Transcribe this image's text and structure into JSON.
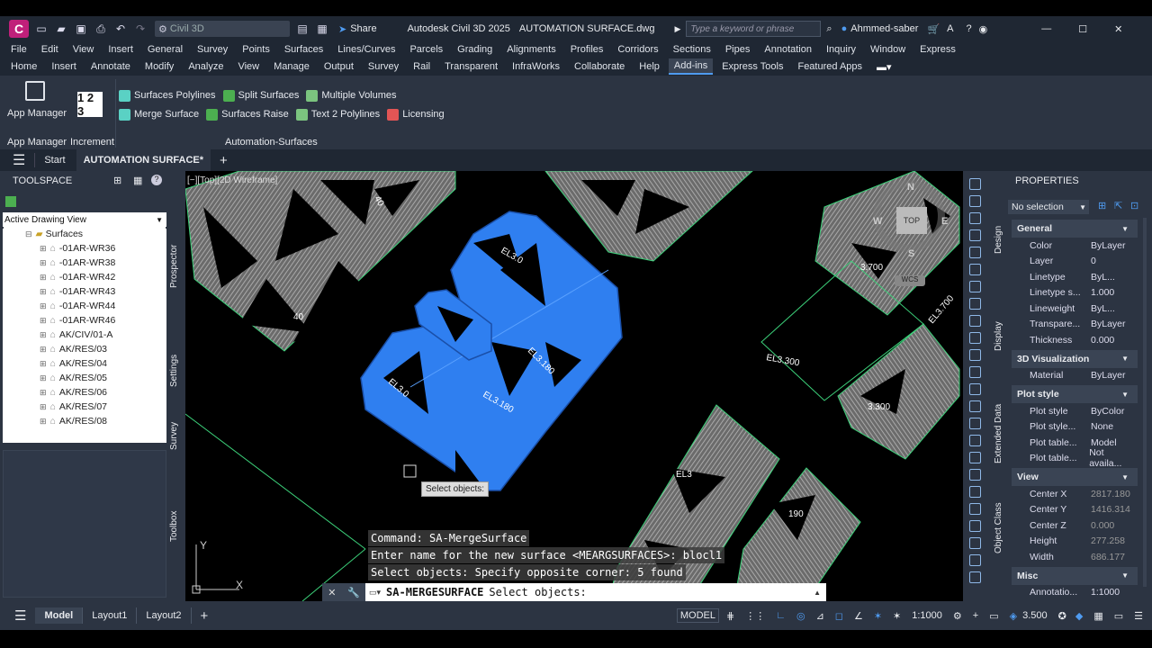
{
  "app": {
    "title": "Autodesk Civil 3D 2025",
    "file": "AUTOMATION SURFACE.dwg",
    "workspace": "Civil 3D",
    "share": "Share",
    "search_placeholder": "Type a keyword or phrase",
    "user": "Ahmmed-saber"
  },
  "menu": [
    "File",
    "Edit",
    "View",
    "Insert",
    "General",
    "Survey",
    "Points",
    "Surfaces",
    "Lines/Curves",
    "Parcels",
    "Grading",
    "Alignments",
    "Profiles",
    "Corridors",
    "Sections",
    "Pipes",
    "Annotation",
    "Inquiry",
    "Window",
    "Express"
  ],
  "ribbon_tabs": [
    "Home",
    "Insert",
    "Annotate",
    "Modify",
    "Analyze",
    "View",
    "Manage",
    "Output",
    "Survey",
    "Rail",
    "Transparent",
    "InfraWorks",
    "Collaborate",
    "Help",
    "Add-ins",
    "Express Tools",
    "Featured Apps"
  ],
  "ribbon_active": "Add-ins",
  "ribbon": {
    "app_manager": "App Manager",
    "app_manager_panel": "App Manager",
    "increment": "Increment",
    "increment_icon": "1 2 3",
    "automation_panel": "Automation-Surfaces",
    "row1": [
      "Surfaces Polylines",
      "Split Surfaces",
      "Multiple Volumes"
    ],
    "row2": [
      "Merge Surface",
      "Surfaces Raise",
      "Text 2 Polylines",
      "Licensing"
    ]
  },
  "doc_tabs": {
    "start": "Start",
    "active": "AUTOMATION SURFACE*"
  },
  "toolspace": {
    "title": "TOOLSPACE",
    "view": "Active Drawing View",
    "root": "Surfaces",
    "items": [
      "-01AR-WR36",
      "-01AR-WR38",
      "-01AR-WR42",
      "-01AR-WR43",
      "-01AR-WR44",
      "-01AR-WR46",
      "AK/CIV/01-A",
      "AK/RES/03",
      "AK/RES/04",
      "AK/RES/05",
      "AK/RES/06",
      "AK/RES/07",
      "AK/RES/08"
    ],
    "side_tabs": [
      "Prospector",
      "Settings",
      "Survey",
      "Toolbox"
    ]
  },
  "viewport": {
    "label": "[−][Top][2D Wireframe]",
    "viewcube": {
      "top": "TOP",
      "n": "N",
      "s": "S",
      "e": "E",
      "w": "W",
      "wcs": "WCS"
    },
    "tooltip": "Select objects:",
    "elevations": [
      "EL3.0",
      "EL3.180",
      "EL3.180",
      "EL3.300",
      "3.700",
      "EL3.700",
      "3.300",
      "EL3",
      "190",
      "40",
      "40"
    ]
  },
  "command": {
    "history": [
      "Command: SA-MergeSurface",
      "Enter name for the new surface <MEARGSURFACES>: blocl1",
      "Select objects: Specify opposite corner: 5 found"
    ],
    "prompt_cmd": "SA-MERGESURFACE",
    "prompt_text": "Select objects:"
  },
  "properties": {
    "title": "PROPERTIES",
    "selection": "No selection",
    "side_tabs": [
      "Design",
      "Display",
      "Extended Data",
      "Object Class"
    ],
    "sections": [
      {
        "name": "General",
        "rows": [
          [
            "Color",
            "ByLayer"
          ],
          [
            "Layer",
            "0"
          ],
          [
            "Linetype",
            "ByL..."
          ],
          [
            "Linetype s...",
            "1.000"
          ],
          [
            "Lineweight",
            "ByL..."
          ],
          [
            "Transpare...",
            "ByLayer"
          ],
          [
            "Thickness",
            "0.000"
          ]
        ]
      },
      {
        "name": "3D Visualization",
        "rows": [
          [
            "Material",
            "ByLayer"
          ]
        ]
      },
      {
        "name": "Plot style",
        "rows": [
          [
            "Plot style",
            "ByColor"
          ],
          [
            "Plot style...",
            "None"
          ],
          [
            "Plot table...",
            "Model"
          ],
          [
            "Plot table...",
            "Not availa..."
          ]
        ]
      },
      {
        "name": "View",
        "rows": [
          [
            "Center X",
            "2817.180"
          ],
          [
            "Center Y",
            "1416.314"
          ],
          [
            "Center Z",
            "0.000"
          ],
          [
            "Height",
            "277.258"
          ],
          [
            "Width",
            "686.177"
          ]
        ]
      },
      {
        "name": "Misc",
        "rows": [
          [
            "Annotatio...",
            "1:1000"
          ]
        ]
      }
    ]
  },
  "status": {
    "tabs": [
      "Model",
      "Layout1",
      "Layout2"
    ],
    "model": "MODEL",
    "scale": "1:1000",
    "elev": "3.500"
  },
  "colors": {
    "accent": "#4f9bf0",
    "selection_blue": "#2f7ff0",
    "surface_gray": "#8a8a8a",
    "boundary": "#3cd17a"
  }
}
